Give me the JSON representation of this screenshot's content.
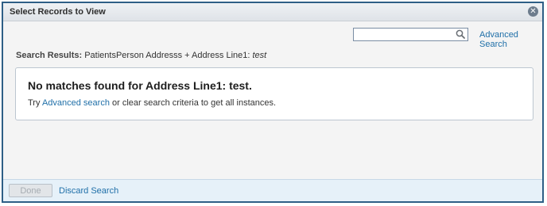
{
  "dialog": {
    "title": "Select Records to View",
    "close_icon": "close-icon"
  },
  "search": {
    "value": "",
    "placeholder": "",
    "icon": "search-icon",
    "advanced_label": "Advanced Search"
  },
  "results": {
    "label": "Search Results:",
    "criteria": "PatientsPerson Addresss + Address Line1:",
    "term": "test"
  },
  "no_matches": {
    "title": "No matches found for Address Line1: test.",
    "hint_prefix": "Try",
    "hint_link": "Advanced search",
    "hint_suffix": "or clear search criteria to get all instances."
  },
  "footer": {
    "done_label": "Done",
    "done_disabled": true,
    "discard_label": "Discard Search"
  },
  "colors": {
    "border": "#2e5f86",
    "link": "#1f6fa8",
    "footer_bg": "#e6f1f9"
  }
}
